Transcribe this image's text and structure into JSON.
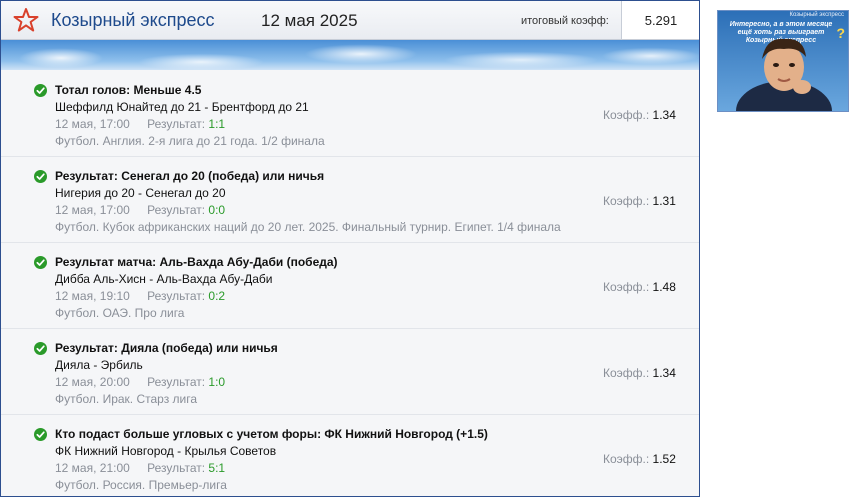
{
  "header": {
    "title": "Козырный экспресс",
    "date": "12 мая 2025",
    "total_coef_label": "итоговый коэфф:",
    "total_coef_value": "5.291"
  },
  "colors": {
    "brand_blue": "#1e4a8c",
    "success_green": "#2a9a2a",
    "star_red": "#d9412c"
  },
  "labels": {
    "result": "Результат:",
    "coef": "Коэфф.:"
  },
  "bets": [
    {
      "market": "Тотал голов: Меньше 4.5",
      "teams": "Шеффилд Юнайтед до 21 - Брентфорд до 21",
      "datetime": "12 мая, 17:00",
      "score": "1:1",
      "league": "Футбол. Англия. 2-я лига до 21 года. 1/2 финала",
      "odd": "1.34",
      "status_icon": "check-circle-icon"
    },
    {
      "market": "Результат: Сенегал до 20 (победа) или ничья",
      "teams": "Нигерия до 20 - Сенегал до 20",
      "datetime": "12 мая, 17:00",
      "score": "0:0",
      "league": "Футбол. Кубок африканских наций до 20 лет. 2025. Финальный турнир. Египет. 1/4 финала",
      "odd": "1.31",
      "status_icon": "check-circle-icon"
    },
    {
      "market": "Результат матча: Аль-Вахда Абу-Даби (победа)",
      "teams": "Дибба Аль-Хисн - Аль-Вахда Абу-Даби",
      "datetime": "12 мая, 19:10",
      "score": "0:2",
      "league": "Футбол. ОАЭ. Про лига",
      "odd": "1.48",
      "status_icon": "check-circle-icon"
    },
    {
      "market": "Результат: Дияла (победа) или ничья",
      "teams": "Дияла - Эрбиль",
      "datetime": "12 мая, 20:00",
      "score": "1:0",
      "league": "Футбол. Ирак. Старз лига",
      "odd": "1.34",
      "status_icon": "check-circle-icon"
    },
    {
      "market": "Кто подаст больше угловых с учетом форы: ФК Нижний Новгород (+1.5)",
      "teams": "ФК Нижний Новгород - Крылья Советов",
      "datetime": "12 мая, 21:00",
      "score": "5:1",
      "league": "Футбол. Россия. Премьер-лига",
      "odd": "1.52",
      "status_icon": "check-circle-icon"
    }
  ],
  "ad": {
    "topline": "Козырный экспресс",
    "text": "Интересно, а в этом месяце ещё хоть раз выиграет Козырный экспресс",
    "question_mark": "?"
  }
}
